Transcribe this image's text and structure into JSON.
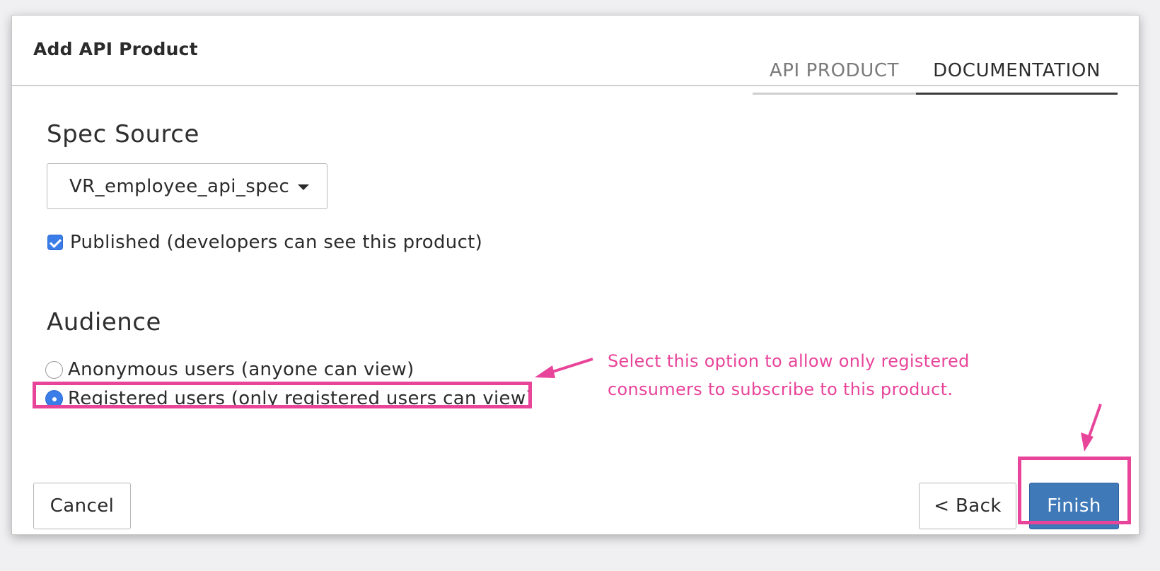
{
  "dialog": {
    "title": "Add API Product",
    "tabs": [
      {
        "label": "API PRODUCT",
        "active": false
      },
      {
        "label": "DOCUMENTATION",
        "active": true
      }
    ]
  },
  "spec_source": {
    "title": "Spec Source",
    "selected": "VR_employee_api_spec",
    "published": {
      "label": "Published (developers can see this product)",
      "checked": true
    }
  },
  "audience": {
    "title": "Audience",
    "options": [
      {
        "label": "Anonymous users (anyone can view)",
        "selected": false
      },
      {
        "label": "Registered users (only registered users can view)",
        "selected": true
      }
    ]
  },
  "annotation": {
    "line1": "Select this option to allow only registered",
    "line2": "consumers to subscribe to this product.",
    "color": "#e8449a"
  },
  "footer": {
    "cancel": "Cancel",
    "back": "< Back",
    "finish": "Finish"
  },
  "colors": {
    "accent": "#3b7de8",
    "primary_button": "#3f79b8",
    "highlight": "#e8449a"
  },
  "icons": [
    "dropdown-caret-icon",
    "checkmark-icon",
    "radio-dot-icon",
    "arrow-icon"
  ]
}
